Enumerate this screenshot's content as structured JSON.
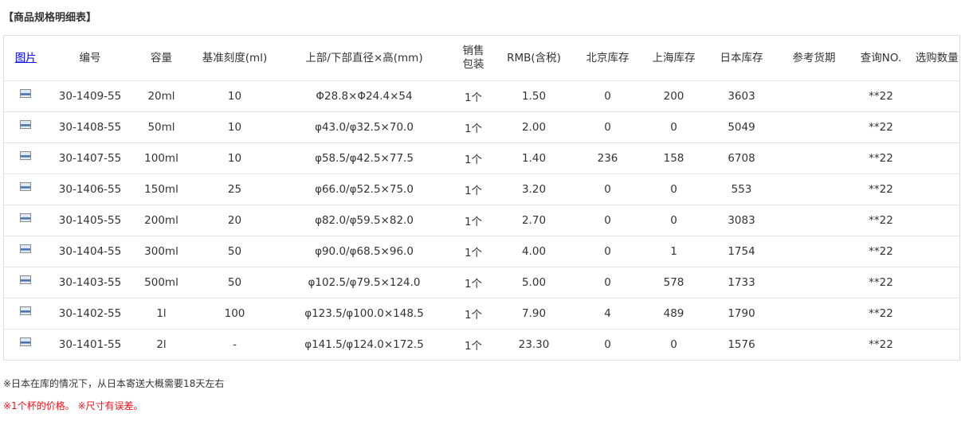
{
  "section_title": "【商品规格明细表】",
  "headers": {
    "image": "图片",
    "code": "编号",
    "capacity": "容量",
    "scale": "基准刻度(ml)",
    "dimensions": "上部/下部直径×高(mm)",
    "package_line1": "销售",
    "package_line2": "包装",
    "price": "RMB(含税)",
    "beijing": "北京库存",
    "shanghai": "上海库存",
    "japan": "日本库存",
    "lead_time": "参考货期",
    "query_no": "查询NO.",
    "quantity": "选购数量"
  },
  "rows": [
    {
      "code": "30-1409-55",
      "capacity": "20ml",
      "scale": "10",
      "dimensions": "Φ28.8×Φ24.4×54",
      "package": "1个",
      "price": "1.50",
      "beijing": "0",
      "shanghai": "200",
      "japan": "3603",
      "lead_time": "",
      "query_no": "**22"
    },
    {
      "code": "30-1408-55",
      "capacity": "50ml",
      "scale": "10",
      "dimensions": "φ43.0/φ32.5×70.0",
      "package": "1个",
      "price": "2.00",
      "beijing": "0",
      "shanghai": "0",
      "japan": "5049",
      "lead_time": "",
      "query_no": "**22"
    },
    {
      "code": "30-1407-55",
      "capacity": "100ml",
      "scale": "10",
      "dimensions": "φ58.5/φ42.5×77.5",
      "package": "1个",
      "price": "1.40",
      "beijing": "236",
      "shanghai": "158",
      "japan": "6708",
      "lead_time": "",
      "query_no": "**22"
    },
    {
      "code": "30-1406-55",
      "capacity": "150ml",
      "scale": "25",
      "dimensions": "φ66.0/φ52.5×75.0",
      "package": "1个",
      "price": "3.20",
      "beijing": "0",
      "shanghai": "0",
      "japan": "553",
      "lead_time": "",
      "query_no": "**22"
    },
    {
      "code": "30-1405-55",
      "capacity": "200ml",
      "scale": "20",
      "dimensions": "φ82.0/φ59.5×82.0",
      "package": "1个",
      "price": "2.70",
      "beijing": "0",
      "shanghai": "0",
      "japan": "3083",
      "lead_time": "",
      "query_no": "**22"
    },
    {
      "code": "30-1404-55",
      "capacity": "300ml",
      "scale": "50",
      "dimensions": "φ90.0/φ68.5×96.0",
      "package": "1个",
      "price": "4.00",
      "beijing": "0",
      "shanghai": "1",
      "japan": "1754",
      "lead_time": "",
      "query_no": "**22"
    },
    {
      "code": "30-1403-55",
      "capacity": "500ml",
      "scale": "50",
      "dimensions": "φ102.5/φ79.5×124.0",
      "package": "1个",
      "price": "5.00",
      "beijing": "0",
      "shanghai": "578",
      "japan": "1733",
      "lead_time": "",
      "query_no": "**22"
    },
    {
      "code": "30-1402-55",
      "capacity": "1l",
      "scale": "100",
      "dimensions": "φ123.5/φ100.0×148.5",
      "package": "1个",
      "price": "7.90",
      "beijing": "4",
      "shanghai": "489",
      "japan": "1790",
      "lead_time": "",
      "query_no": "**22"
    },
    {
      "code": "30-1401-55",
      "capacity": "2l",
      "scale": "-",
      "dimensions": "φ141.5/φ124.0×172.5",
      "package": "1个",
      "price": "23.30",
      "beijing": "0",
      "shanghai": "0",
      "japan": "1576",
      "lead_time": "",
      "query_no": "**22"
    }
  ],
  "notes": {
    "japan_shipping": "※日本在库的情况下，从日本寄送大概需要18天左右",
    "price_size": "※1个杯的价格。 ※尺寸有误差。"
  },
  "colors": {
    "price": "#e8141c",
    "link": "#0000ee",
    "border": "#e3e3e3"
  },
  "icons": {
    "row_image": "image-thumbnail-icon"
  }
}
